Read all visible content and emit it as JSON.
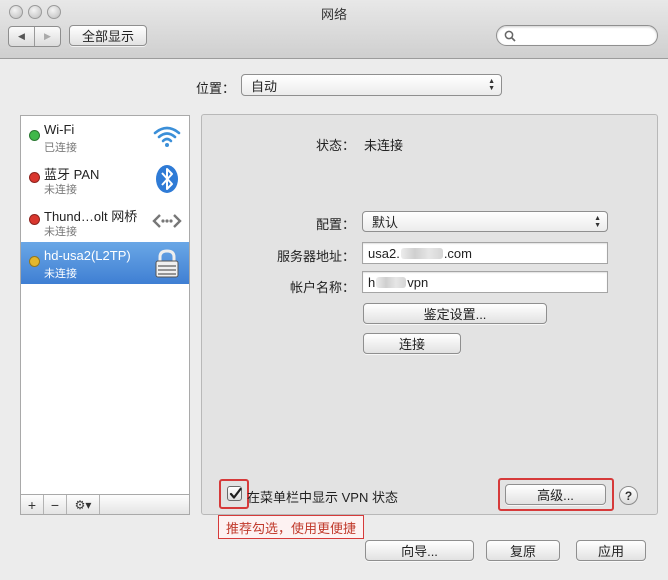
{
  "window": {
    "title": "网络"
  },
  "toolbar": {
    "show_all": "全部显示",
    "back_glyph": "◀",
    "forward_glyph": "▶",
    "search_placeholder": ""
  },
  "location": {
    "label": "位置：",
    "value": "自动"
  },
  "services": [
    {
      "name": "Wi-Fi",
      "status": "已连接",
      "dot_color": "#3fb84a",
      "icon": "wifi-icon"
    },
    {
      "name": "蓝牙 PAN",
      "status": "未连接",
      "dot_color": "#d9362e",
      "icon": "bluetooth-icon"
    },
    {
      "name": "Thund…olt 网桥",
      "status": "未连接",
      "dot_color": "#d9362e",
      "icon": "thunderbolt-bridge-icon"
    },
    {
      "name": "hd-usa2(L2TP)",
      "status": "未连接",
      "dot_color": "#e3b72c",
      "icon": "vpn-lock-icon"
    }
  ],
  "list_buttons": {
    "add": "+",
    "remove": "−",
    "action": "⚙▾"
  },
  "detail": {
    "status_label": "状态：",
    "status_value": "未连接",
    "config_label": "配置：",
    "config_value": "默认",
    "server_label": "服务器地址：",
    "server_value_prefix": "usa2.",
    "server_value_suffix": ".com",
    "account_label": "帐户名称：",
    "account_value_prefix": "h",
    "account_value_suffix": "vpn",
    "auth_button": "鉴定设置...",
    "connect_button": "连接",
    "show_vpn_checkbox": "在菜单栏中显示 VPN 状态",
    "show_vpn_checked": true,
    "advanced_button": "高级...",
    "help_button": "?"
  },
  "annotation": {
    "note": "推荐勾选，使用更便捷",
    "color": "#d63a3a"
  },
  "footer": {
    "assist": "向导...",
    "revert": "复原",
    "apply": "应用"
  }
}
